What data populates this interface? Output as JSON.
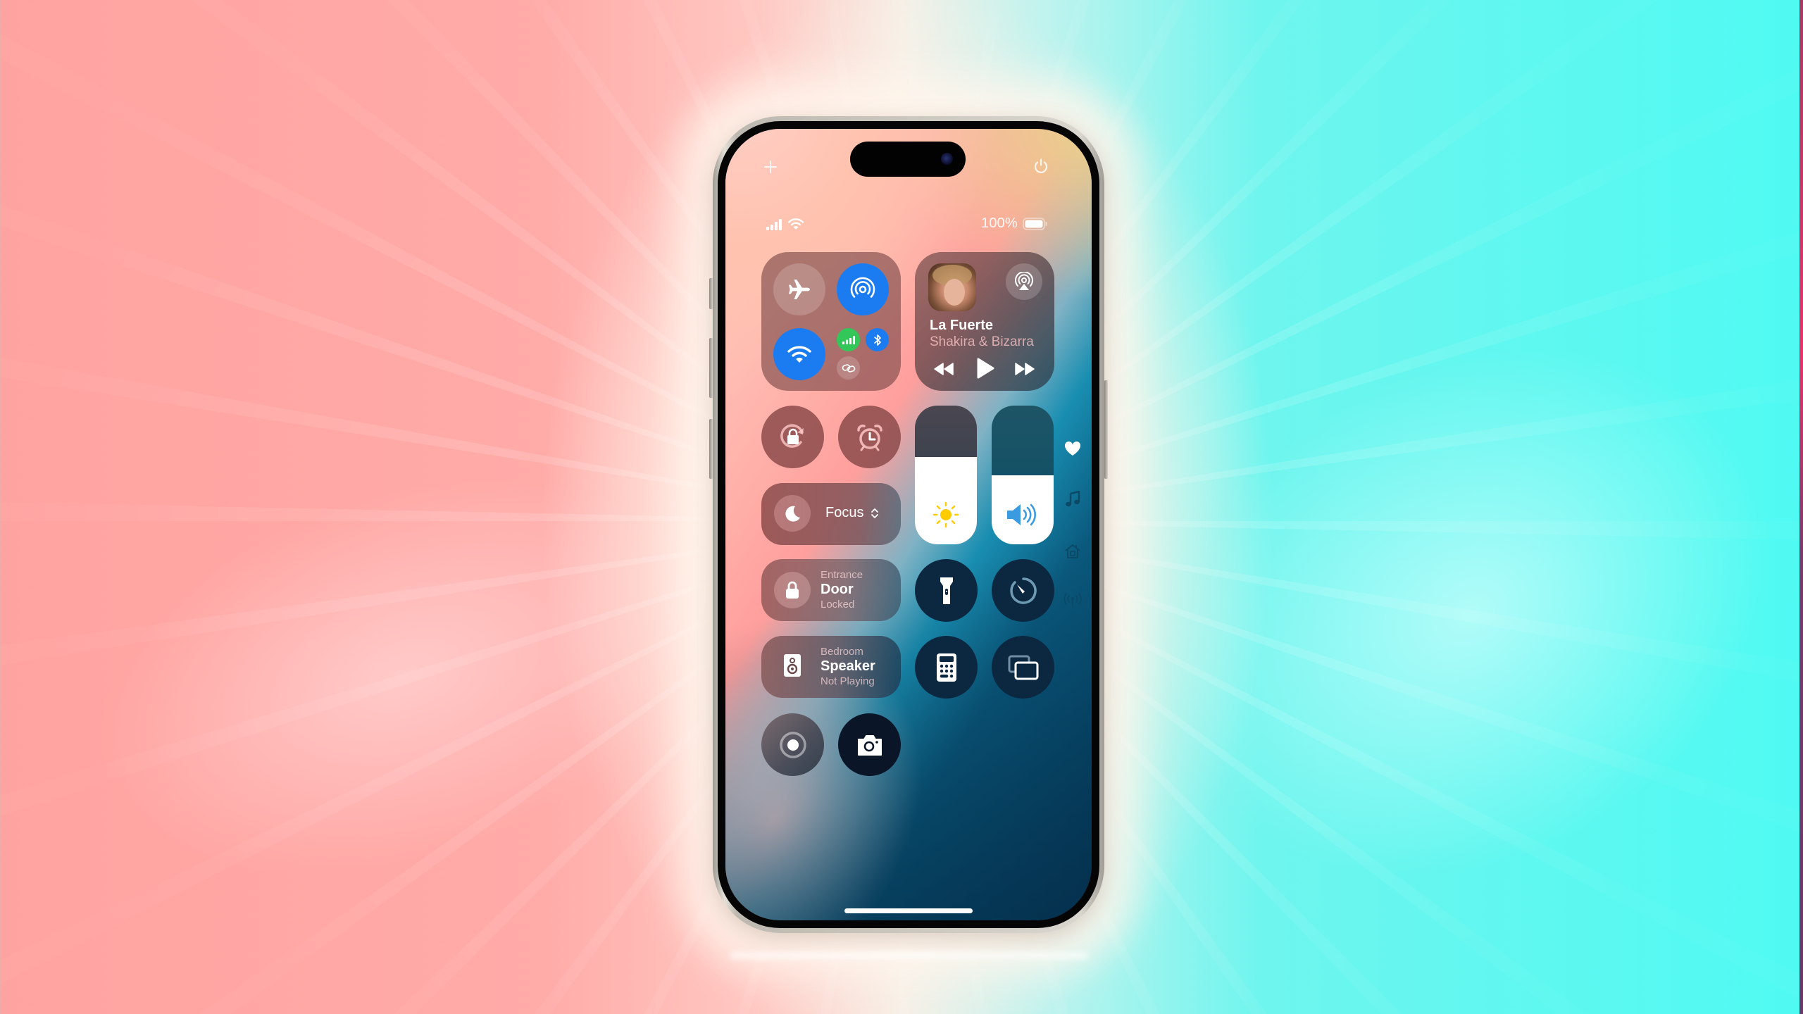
{
  "screen": {
    "top_controls": {
      "add_icon": "plus-icon",
      "power_icon": "power-icon"
    },
    "status_bar": {
      "cellular_icon": "signal-bars-icon",
      "wifi_icon": "wifi-icon",
      "battery_percent": "100%",
      "battery_level": 1.0
    },
    "connectivity": {
      "airplane_mode": {
        "icon": "airplane-icon",
        "active": false
      },
      "airdrop": {
        "icon": "airdrop-icon",
        "active": true
      },
      "wifi": {
        "icon": "wifi-icon",
        "active": true
      },
      "cellular": {
        "icon": "cellular-icon",
        "active": true
      },
      "bluetooth": {
        "icon": "bluetooth-icon",
        "active": true
      },
      "personal_hotspot": {
        "icon": "link-icon",
        "active": false
      }
    },
    "now_playing": {
      "title": "La Fuerte",
      "artist": "Shakira & Bizarrap",
      "artist_truncated": "Shakira & Bizarra",
      "airplay_icon": "airplay-audio-icon",
      "prev_icon": "rewind-icon",
      "play_icon": "play-icon",
      "next_icon": "fast-forward-icon"
    },
    "toggles": {
      "rotation_lock": "rotation-lock-icon",
      "alarm": "alarm-clock-icon"
    },
    "focus": {
      "label": "Focus",
      "icon": "moon-icon"
    },
    "sliders": {
      "brightness": {
        "icon": "sun-icon",
        "level": 0.63,
        "icon_color": "#ffcc00"
      },
      "volume": {
        "icon": "speaker-wave-icon",
        "level": 0.5,
        "icon_color": "#3a9be0"
      }
    },
    "home_tiles": [
      {
        "room": "Entrance",
        "name": "Door",
        "status": "Locked",
        "icon": "lock-icon"
      },
      {
        "room": "Bedroom",
        "name": "Speaker",
        "status": "Not Playing",
        "icon": "speaker-icon"
      }
    ],
    "quick_buttons": {
      "flashlight": "flashlight-icon",
      "timer": "timer-icon",
      "calculator": "calculator-icon",
      "screen_mirroring": "screen-mirroring-icon",
      "screen_recording": "screen-record-icon",
      "camera": "camera-icon"
    },
    "page_indicators": [
      {
        "icon": "heart-icon",
        "active": true
      },
      {
        "icon": "music-note-icon",
        "active": false
      },
      {
        "icon": "home-icon",
        "active": false
      },
      {
        "icon": "antenna-icon",
        "active": false
      }
    ]
  },
  "colors": {
    "accent_blue": "#1b7cf2",
    "cellular_green": "#33c759",
    "background_left": "#ffa3a0",
    "background_right": "#4ffaf2"
  }
}
